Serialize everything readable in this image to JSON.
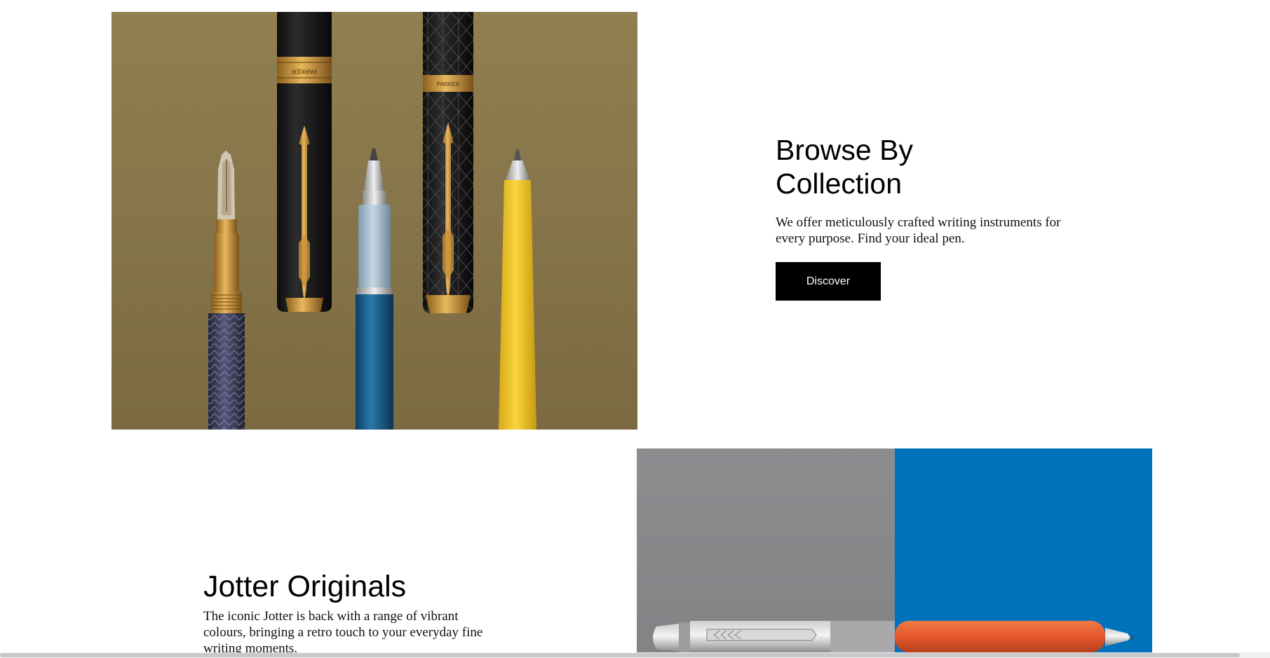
{
  "browse_section": {
    "title": "Browse By Collection",
    "description": "We offer meticulously crafted writing instruments for every purpose. Find your ideal pen.",
    "discover_label": "Discover",
    "pen_engravings": {
      "cap_brand": "PARKER",
      "ring_brand": "PARKER"
    }
  },
  "jotter_section": {
    "title": "Jotter Originals",
    "description": "The iconic Jotter is back with a range of vibrant colours, bringing a retro touch to your everyday fine writing moments."
  },
  "colors": {
    "button_bg": "#000000",
    "hero_bg": "#8c7b4f",
    "jotter_grey": "#8a8a8d",
    "jotter_blue": "#0072bc",
    "jotter_orange": "#e4572e"
  }
}
